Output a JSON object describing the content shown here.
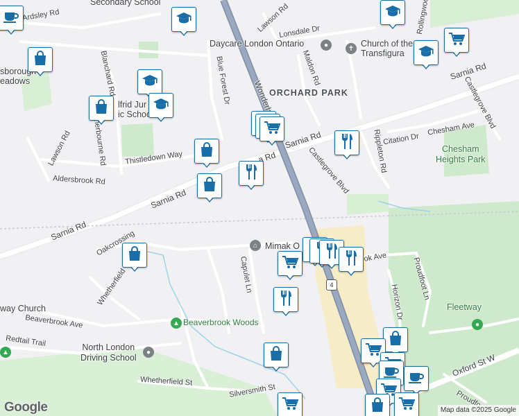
{
  "map": {
    "attribution": "Map data ©2025 Google",
    "logo": "Google",
    "labels": {
      "secondary_school": "Secondary School",
      "ardsley_rd": "Ardsley Rd",
      "lawson_rd_top": "Lawson Rd",
      "lonsdale_dr": "Lonsdale Dr",
      "rollingwood": "Rollingwood",
      "daycare": "Daycare London Ontario",
      "church_transfigura": "Church of the Transfigura",
      "maldon_rd": "Maldon Rd",
      "blanchard_rd": "Blanchard Rd",
      "blue_forest_dr": "Blue Forest Dr",
      "wonderland": "Wonderland",
      "orchard_park": "ORCHARD PARK",
      "sarnia_rd_ne": "Sarnia Rd",
      "castlegrove_blvd_ne": "Castlegrove Blvd",
      "sborough_meadows": "sborough\neadows",
      "wilfrid_school": "lfrid Jur\nic School",
      "sherbourne_rd": "Sherbourne Rd",
      "lawson_rd_left": "Lawson Rd",
      "thistledown_way": "Thistledown Way",
      "sarnia_rd_mid": "Sarnia Rd",
      "sarnia_rd_small": "a Rd",
      "castlegrove_blvd": "Castlegrove Blvd",
      "rippleton_rd": "Rippleton Rd",
      "citation_dr": "Citation Dr",
      "chesham_ave": "Chesham Ave",
      "chesham_heights_park": "Chesham\nHeights Park",
      "aldersbrook_rd": "Aldersbrook Rd",
      "sarnia_rd_left": "Sarnia Rd",
      "sarnia_rd_far": "Sarnia Rd",
      "oakcrossing": "Oakcrossing",
      "mimak": "Mimak O",
      "capulet_ln": "Capulet Ln",
      "brook_ave": "B   ok Ave",
      "proudfoot_ln": "Proudfoot Ln",
      "whetherfield": "Whetherfield",
      "way_church": "way Church",
      "beaverbrook_ave": "Beaverbrook Ave",
      "beaverbrook_woods": "Beaverbrook Woods",
      "horizon_dr": "Horizon Dr",
      "fleetway": "Fleetway",
      "redtail_trail": "Redtail Trail",
      "north_london_driving": "North London\nDriving School",
      "oxford_st_w": "Oxford St W",
      "whetherfield_st": "Whetherfield St",
      "silversmith_st": "Silversmith St",
      "highway_shield": "4",
      "proudfo": "Proudfo"
    },
    "colors": {
      "background": "#f1f1f4",
      "road_major": "#ffffff",
      "highway": "#8a9bb5",
      "park": "#cfe9cd",
      "commercial": "#f6ecc8",
      "marker_border": "#1a6ea8"
    },
    "markers": [
      {
        "type": "cafe",
        "icon": "coffee-cup-icon"
      },
      {
        "type": "school",
        "icon": "graduation-cap-icon"
      },
      {
        "type": "shopping",
        "icon": "shopping-bag-icon"
      },
      {
        "type": "school",
        "icon": "graduation-cap-icon"
      },
      {
        "type": "school",
        "icon": "graduation-cap-icon"
      },
      {
        "type": "shopping",
        "icon": "shopping-bag-icon"
      },
      {
        "type": "school",
        "icon": "graduation-cap-icon"
      },
      {
        "type": "grocery",
        "icon": "shopping-cart-icon"
      },
      {
        "type": "school",
        "icon": "graduation-cap-icon"
      },
      {
        "type": "grocery",
        "icon": "shopping-cart-icon"
      },
      {
        "type": "grocery",
        "icon": "shopping-cart-icon"
      },
      {
        "type": "grocery",
        "icon": "shopping-cart-icon"
      },
      {
        "type": "restaurant",
        "icon": "fork-knife-icon"
      },
      {
        "type": "shopping",
        "icon": "shopping-bag-icon"
      },
      {
        "type": "restaurant",
        "icon": "fork-knife-icon"
      },
      {
        "type": "shopping",
        "icon": "shopping-bag-icon"
      },
      {
        "type": "shopping",
        "icon": "shopping-bag-icon"
      },
      {
        "type": "restaurant",
        "icon": "fork-knife-icon"
      },
      {
        "type": "restaurant",
        "icon": "fork-knife-icon"
      },
      {
        "type": "restaurant",
        "icon": "fork-knife-icon"
      },
      {
        "type": "restaurant",
        "icon": "fork-knife-icon"
      },
      {
        "type": "grocery",
        "icon": "shopping-cart-icon"
      },
      {
        "type": "restaurant",
        "icon": "fork-knife-icon"
      },
      {
        "type": "shopping",
        "icon": "shopping-bag-icon"
      },
      {
        "type": "shopping",
        "icon": "shopping-bag-icon"
      },
      {
        "type": "grocery",
        "icon": "shopping-cart-icon"
      },
      {
        "type": "grocery",
        "icon": "shopping-cart-icon"
      },
      {
        "type": "cafe",
        "icon": "coffee-cup-icon"
      },
      {
        "type": "cafe",
        "icon": "coffee-cup-icon"
      },
      {
        "type": "grocery",
        "icon": "shopping-cart-icon"
      },
      {
        "type": "shopping",
        "icon": "shopping-bag-icon"
      },
      {
        "type": "grocery",
        "icon": "shopping-cart-icon"
      },
      {
        "type": "grocery",
        "icon": "shopping-cart-icon"
      }
    ]
  }
}
